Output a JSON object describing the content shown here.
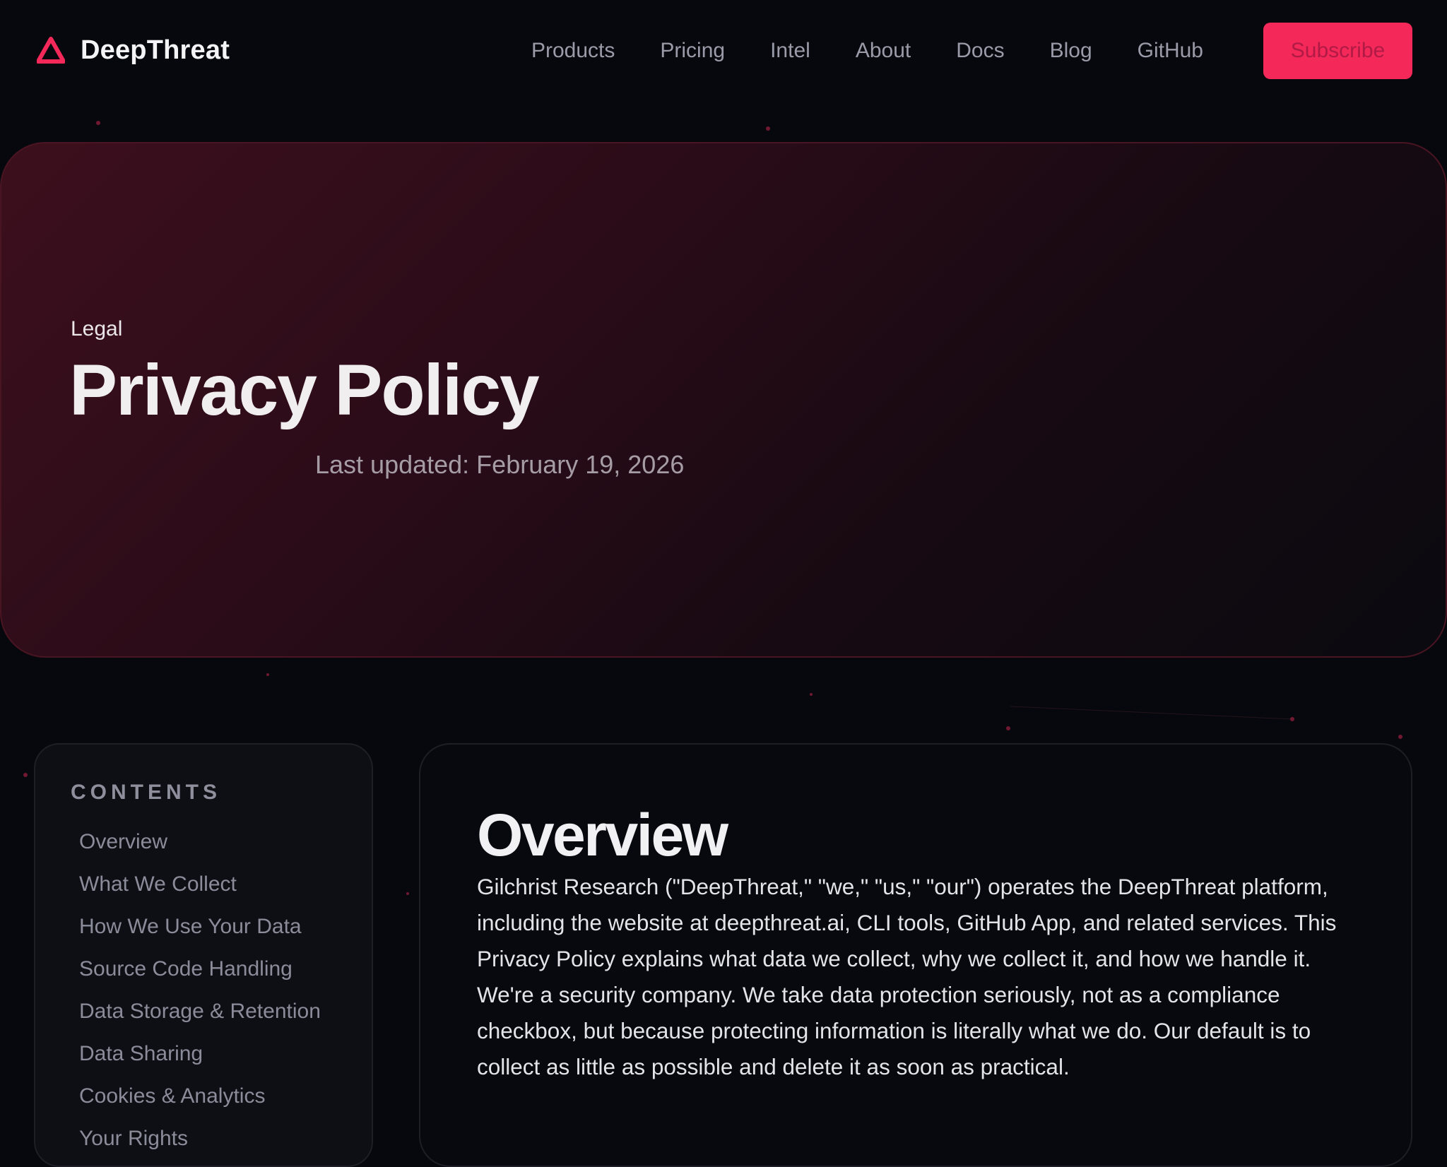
{
  "nav": {
    "brand": "DeepThreat",
    "links": [
      "Products",
      "Pricing",
      "Intel",
      "About",
      "Docs",
      "Blog",
      "GitHub"
    ],
    "subscribe_label": "Subscribe"
  },
  "hero": {
    "eyebrow": "Legal",
    "title": "Privacy Policy",
    "updated": "Last updated: February 19, 2026"
  },
  "toc": {
    "heading": "CONTENTS",
    "items": [
      "Overview",
      "What We Collect",
      "How We Use Your Data",
      "Source Code Handling",
      "Data Storage & Retention",
      "Data Sharing",
      "Cookies & Analytics",
      "Your Rights"
    ]
  },
  "content": {
    "section_title": "Overview",
    "paragraphs": [
      "Gilchrist Research (\"DeepThreat,\" \"we,\" \"us,\" \"our\") operates the DeepThreat platform, including the website at deepthreat.ai, CLI tools, GitHub App, and related services. This Privacy Policy explains what data we collect, why we collect it, and how we handle it.",
      "We're a security company. We take data protection seriously, not as a compliance checkbox, but because protecting information is literally what we do. Our default is to collect as little as possible and delete it as soon as practical."
    ]
  },
  "colors": {
    "background": "#07080d",
    "accent": "#f4295a",
    "hero_gradient_start": "#3d0f1d",
    "muted_text": "#9a9ba8"
  },
  "icons": {
    "brand_logo": "triangle-logo-icon"
  }
}
